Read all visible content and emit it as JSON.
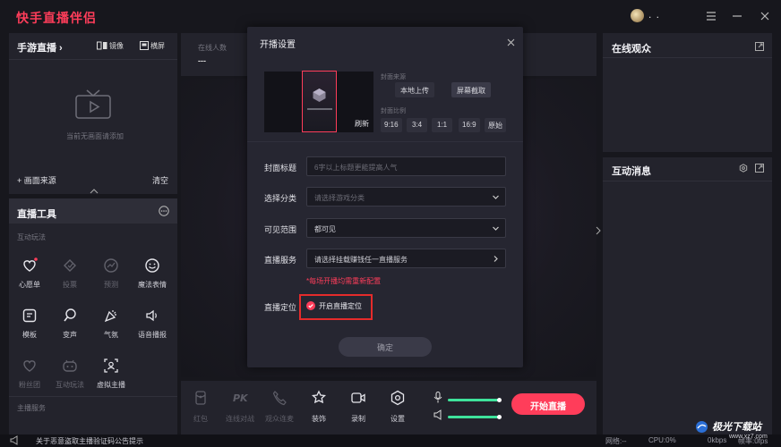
{
  "app": {
    "title": "快手直播伴侣",
    "user_name": ". ."
  },
  "left_panel": {
    "game_live": {
      "title": "手游直播 ›",
      "mirror_label": "镜像",
      "landscape_label": "横屏"
    },
    "empty_text": "当前无画面请添加",
    "add_source_label": "+ 画面来源",
    "clear_label": "清空"
  },
  "tools": {
    "title": "直播工具",
    "section_interactive": "互动玩法",
    "items": [
      {
        "label": "心愿单",
        "icon": "heart-icon"
      },
      {
        "label": "投票",
        "icon": "vote-icon"
      },
      {
        "label": "预测",
        "icon": "predict-icon"
      },
      {
        "label": "魔法表情",
        "icon": "smile-icon"
      },
      {
        "label": "模板",
        "icon": "template-icon"
      },
      {
        "label": "变声",
        "icon": "voice-change-icon"
      },
      {
        "label": "气氛",
        "icon": "party-icon"
      },
      {
        "label": "语音播报",
        "icon": "speaker-icon"
      },
      {
        "label": "粉丝团",
        "icon": "fan-heart-icon"
      },
      {
        "label": "互动玩法",
        "icon": "game-icon"
      },
      {
        "label": "虚拟主播",
        "icon": "virtual-anchor-icon"
      }
    ],
    "section_host_service": "主播服务"
  },
  "stats": {
    "online_label": "在线人数",
    "online_value": "---"
  },
  "dialog": {
    "title": "开播设置",
    "refresh_label": "刷新",
    "cover_source_label": "封面来源",
    "upload_label": "本地上传",
    "screenshot_label": "屏幕截取",
    "cover_ratio_label": "封面比例",
    "ratios": [
      "9:16",
      "3:4",
      "1:1",
      "16:9",
      "原始"
    ],
    "title_label": "封面标题",
    "title_placeholder": "6字以上标题更能提高人气",
    "category_label": "选择分类",
    "category_placeholder": "请选择游戏分类",
    "visibility_label": "可见范围",
    "visibility_value": "都可见",
    "service_label": "直播服务",
    "service_value": "请选择挂载赚钱任一直播服务",
    "warning": "*每场开播均需重新配置",
    "location_label": "直播定位",
    "location_toggle_label": "开启直播定位",
    "confirm_label": "确定"
  },
  "bottom_bar": {
    "tools": [
      {
        "label": "红包",
        "icon": "red-packet-icon",
        "dim": true
      },
      {
        "label": "连线对战",
        "icon": "pk-icon",
        "dim": true
      },
      {
        "label": "观众连麦",
        "icon": "phone-icon",
        "dim": true
      },
      {
        "label": "装饰",
        "icon": "decoration-icon",
        "dim": false
      },
      {
        "label": "录制",
        "icon": "record-icon",
        "dim": false
      },
      {
        "label": "设置",
        "icon": "settings-icon",
        "dim": false
      }
    ],
    "mic_level": 0.95,
    "speaker_level": 0.95,
    "start_label": "开始直播"
  },
  "right_panel": {
    "viewers_title": "在线观众",
    "messages_title": "互动消息"
  },
  "status_bar": {
    "notice": "关于恶意盗取主播验证码公告提示",
    "network_label": "网络:--",
    "cpu_label": "CPU:0%",
    "upload_speed": "0kbps",
    "frame_label": "帧率:0fps",
    "watermark_title": "极光下载站",
    "watermark_url": "www.xz7.com"
  },
  "colors": {
    "accent": "#ff3d5a",
    "highlight_box": "#e52b2b",
    "level_green": "#3ee29b"
  }
}
